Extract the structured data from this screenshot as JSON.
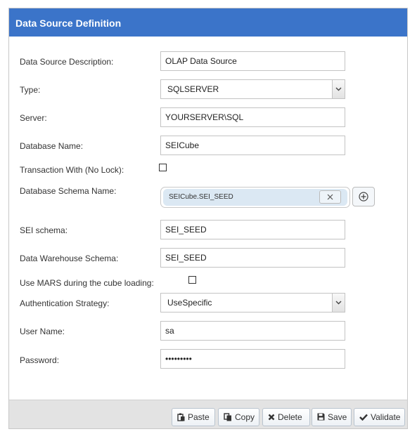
{
  "dialog": {
    "title": "Data Source Definition"
  },
  "form": {
    "description": {
      "label": "Data Source Description:",
      "value": "OLAP Data Source"
    },
    "type": {
      "label": "Type:",
      "value": "SQLSERVER"
    },
    "server": {
      "label": "Server:",
      "value": "YOURSERVER\\SQL"
    },
    "database_name": {
      "label": "Database Name:",
      "value": "SEICube"
    },
    "no_lock": {
      "label": "Transaction With (No Lock):",
      "checked": false
    },
    "schema_name": {
      "label": "Database Schema Name:",
      "tags": [
        "SEICube.SEI_SEED"
      ]
    },
    "sei_schema": {
      "label": "SEI schema:",
      "value": "SEI_SEED"
    },
    "dw_schema": {
      "label": "Data Warehouse Schema:",
      "value": "SEI_SEED"
    },
    "use_mars": {
      "label": "Use MARS during the cube loading:",
      "checked": false
    },
    "auth_strategy": {
      "label": "Authentication Strategy:",
      "value": "UseSpecific"
    },
    "user_name": {
      "label": "User Name:",
      "value": "sa"
    },
    "password": {
      "label": "Password:",
      "value": "secretpwd"
    }
  },
  "footer": {
    "paste_label": "Paste",
    "copy_label": "Copy",
    "delete_label": "Delete",
    "save_label": "Save",
    "validate_label": "Validate"
  },
  "colors": {
    "title_bar": "#3b74c9",
    "tag_chip": "#dbe8f3",
    "footer": "#e3e3e3"
  },
  "icons": [
    "chevron-down-icon",
    "close-icon",
    "plus-circle-icon",
    "paste-icon",
    "copy-icon",
    "delete-icon",
    "save-icon",
    "check-icon"
  ]
}
